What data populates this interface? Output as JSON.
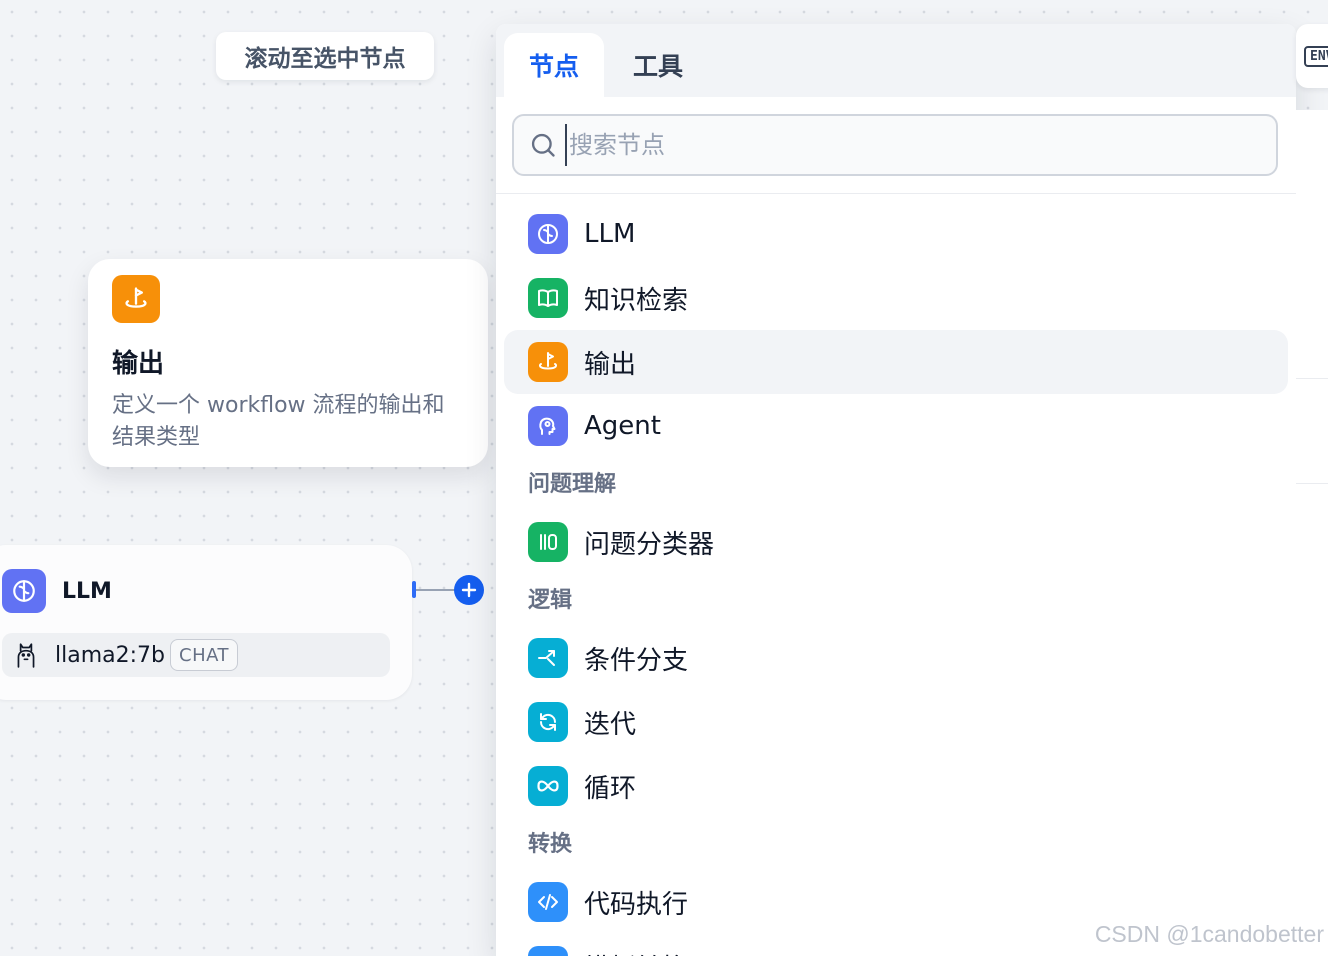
{
  "canvas": {
    "scroll_button_label": "滚动至选中节点",
    "env_label": "ENV"
  },
  "tooltip": {
    "title": "输出",
    "description": "定义一个 workflow 流程的输出和结果类型",
    "icon": "output-icon"
  },
  "llm_node": {
    "title": "LLM",
    "model": "llama2:7b",
    "model_badge": "CHAT",
    "icon": "brain-icon"
  },
  "panel": {
    "tabs": [
      {
        "label": "节点",
        "active": true
      },
      {
        "label": "工具",
        "active": false
      }
    ],
    "search": {
      "placeholder": "搜索节点",
      "value": ""
    },
    "items": [
      {
        "label": "LLM",
        "icon": "brain-icon",
        "color": "#6172f3",
        "highlighted": false
      },
      {
        "label": "知识检索",
        "icon": "book-icon",
        "color": "#16b364",
        "highlighted": false
      },
      {
        "label": "输出",
        "icon": "output-icon",
        "color": "#f79009",
        "highlighted": true
      },
      {
        "label": "Agent",
        "icon": "agent-icon",
        "color": "#6172f3",
        "highlighted": false
      },
      {
        "label": "问题分类器",
        "icon": "classifier-icon",
        "color": "#16b364",
        "highlighted": false
      },
      {
        "label": "条件分支",
        "icon": "branch-icon",
        "color": "#06aed4",
        "highlighted": false
      },
      {
        "label": "迭代",
        "icon": "iteration-icon",
        "color": "#06aed4",
        "highlighted": false
      },
      {
        "label": "循环",
        "icon": "loop-icon",
        "color": "#06aed4",
        "highlighted": false
      },
      {
        "label": "代码执行",
        "icon": "code-icon",
        "color": "#2e90fa",
        "highlighted": false
      },
      {
        "label": "模板转换",
        "icon": "template-icon",
        "color": "#2e90fa",
        "highlighted": false
      }
    ],
    "groups": [
      "问题理解",
      "逻辑",
      "转换"
    ]
  },
  "watermark": "CSDN @1candobetter"
}
